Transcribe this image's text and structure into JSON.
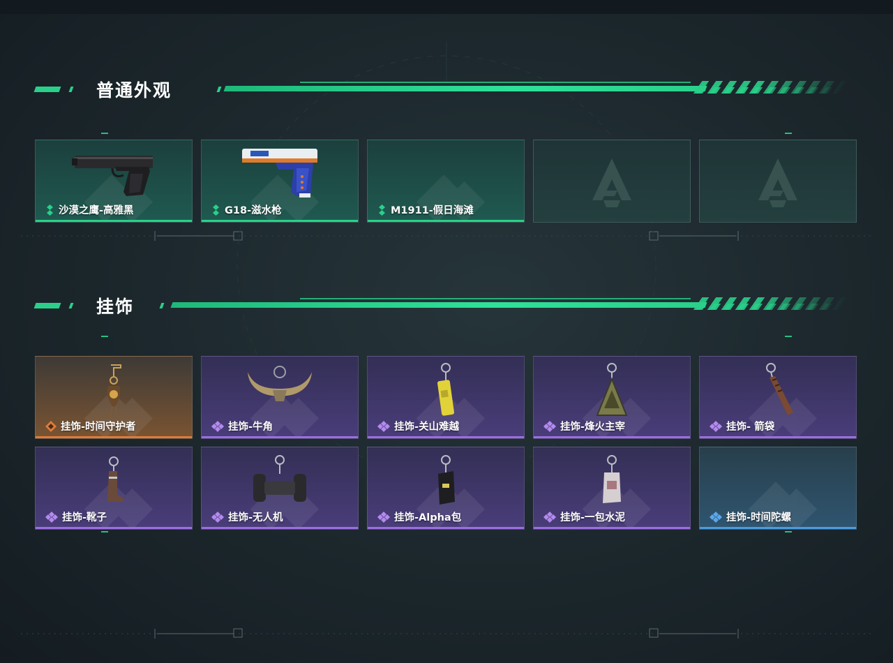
{
  "sections": [
    {
      "title": "普通外观",
      "items": [
        {
          "label": "沙漠之鹰-高雅黑",
          "rarity": "green",
          "icon": "desert-eagle-pistol-icon"
        },
        {
          "label": "G18-滋水枪",
          "rarity": "green",
          "icon": "g18-water-pistol-icon"
        },
        {
          "label": "M1911-假日海滩",
          "rarity": "green",
          "icon": ""
        },
        {
          "label": "",
          "rarity": "empty",
          "icon": "locked-slot-logo-icon"
        },
        {
          "label": "",
          "rarity": "empty",
          "icon": "locked-slot-logo-icon"
        }
      ]
    },
    {
      "title": "挂饰",
      "items": [
        {
          "label": "挂饰-时间守护者",
          "rarity": "orange",
          "icon": "time-guardian-charm-icon"
        },
        {
          "label": "挂饰-牛角",
          "rarity": "purple",
          "icon": "bull-horn-charm-icon"
        },
        {
          "label": "挂饰-关山难越",
          "rarity": "purple",
          "icon": "yellow-can-charm-icon"
        },
        {
          "label": "挂饰-烽火主宰",
          "rarity": "purple",
          "icon": "triangle-pendant-charm-icon"
        },
        {
          "label": "挂饰- 箭袋",
          "rarity": "purple",
          "icon": "quiver-charm-icon"
        },
        {
          "label": "挂饰-靴子",
          "rarity": "purple",
          "icon": "boot-charm-icon"
        },
        {
          "label": "挂饰-无人机",
          "rarity": "purple",
          "icon": "drone-charm-icon"
        },
        {
          "label": "挂饰-Alpha包",
          "rarity": "purple",
          "icon": "alpha-pack-charm-icon"
        },
        {
          "label": "挂饰-一包水泥",
          "rarity": "purple",
          "icon": "cement-bag-charm-icon"
        },
        {
          "label": "挂饰-时间陀螺",
          "rarity": "blue",
          "icon": ""
        }
      ]
    }
  ],
  "colors": {
    "accent": "#2ad08a",
    "green": "#2ad08a",
    "purple": "#9b6ee0",
    "orange": "#e07b3a",
    "blue": "#4a9be0"
  }
}
